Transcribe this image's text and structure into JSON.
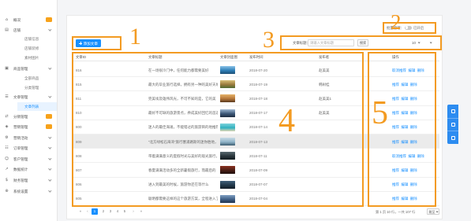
{
  "colors": {
    "accent": "#1890ff",
    "annotation": "#f39b22",
    "badge": "#f7a21b",
    "active_bg": "#e8f3ff",
    "float_bar": "#2d8cf0",
    "row_hover": "#ebebeb"
  },
  "sidebar": {
    "items": [
      {
        "label": "概况",
        "icon": "home-icon",
        "badge": true
      },
      {
        "label": "店铺",
        "icon": "shop-icon",
        "chevron": true
      },
      {
        "label": "店铺信息",
        "sub": true
      },
      {
        "label": "店铺装修",
        "sub": true
      },
      {
        "label": "素材图片",
        "sub": true
      },
      {
        "label": "商品管理",
        "icon": "box-icon",
        "chevron": true
      },
      {
        "label": "全部商品",
        "sub": true
      },
      {
        "label": "分类管理",
        "sub": true
      },
      {
        "label": "文章管理",
        "icon": "document-icon",
        "chevron": true
      },
      {
        "label": "文章列表",
        "sub": true,
        "active": true
      },
      {
        "label": "分销管理",
        "icon": "share-icon",
        "badge": true
      },
      {
        "label": "营销管理",
        "icon": "gift-icon",
        "badge": true
      },
      {
        "label": "营销活动",
        "icon": "gear-icon",
        "chevron": true
      },
      {
        "label": "订单管理",
        "icon": "list-icon",
        "chevron": true
      },
      {
        "label": "客户管理",
        "icon": "user-icon",
        "chevron": true
      },
      {
        "label": "数据统计",
        "icon": "chart-icon",
        "chevron": true
      },
      {
        "label": "财务管理",
        "icon": "dollar-icon",
        "chevron": true
      },
      {
        "label": "系统设置",
        "icon": "settings-icon",
        "chevron": true
      }
    ]
  },
  "toolbar": {
    "add_icon": "plus-icon",
    "add_label": "添加文章",
    "batch_label": "批量管理：",
    "batch_status": "已开启",
    "batch_on": true
  },
  "search": {
    "label": "文章标题：",
    "placeholder": "请输入文章标题",
    "button": "搜索",
    "page_size": "10"
  },
  "table": {
    "headers": [
      "文章ID",
      "文章标题",
      "文章封面图",
      "发布时间",
      "发布者",
      "操作"
    ],
    "hover_row": 5,
    "rows": [
      {
        "id": "816",
        "title": "在一场很冷门中，任何能力都需要美好",
        "thumb": [
          "#8cc3e8",
          "#2e7fb8",
          "#1d4f75"
        ],
        "date": "2018-07-20",
        "author": "赵美美",
        "actions": [
          "取消推荐",
          "编辑",
          "删除"
        ]
      },
      {
        "id": "815",
        "title": "最大的毕业旅行选择，拥有另一种的美好天地",
        "thumb": [
          "#d9c27a",
          "#9a7a3c",
          "#4f6a32"
        ],
        "date": "2018-07-19",
        "author": "韩树桂",
        "actions": [
          "推荐",
          "编辑",
          "删除"
        ]
      },
      {
        "id": "811",
        "title": "完美埃及雄伟风光，不可不知的是，它的美",
        "thumb": [
          "#e6b36a",
          "#b57638",
          "#5a3a20"
        ],
        "date": "2018-07-18",
        "author": "赵美美1",
        "actions": [
          "推荐",
          "编辑",
          "删除"
        ]
      },
      {
        "id": "810",
        "title": "最好不可缺的旅游景点，养成美好回忆的首选",
        "thumb": [
          "#9fb8d2",
          "#3d5878",
          "#1e2c40"
        ],
        "date": "2018-07-17",
        "author": "赵美美",
        "actions": [
          "推荐",
          "编辑",
          "删除"
        ]
      },
      {
        "id": "800",
        "title": "迷人的最佳海滩，不能错过的旅游目的地推荐",
        "thumb": [
          "#7fd3dc",
          "#2fb0c0",
          "#e3d8b4"
        ],
        "date": "2018-07-14",
        "author": "",
        "actions": [
          "推荐",
          "编辑",
          "删除"
        ]
      },
      {
        "id": "809",
        "title": "“北方绿松石海湾”旅行塞浦路斯的迷你胜地，你值得拥有！",
        "thumb": [
          "#c9dbe6",
          "#8fb4c8",
          "#3c5c70"
        ],
        "date": "2018-07-13",
        "author": "",
        "actions": [
          "推荐",
          "编辑",
          "删除"
        ]
      },
      {
        "id": "808",
        "title": "带着满满意义的度假时光与美好的观光旅行，预算外",
        "thumb": [
          "#5a6a70",
          "#2a363c",
          "#141c20"
        ],
        "date": "2018-07-11",
        "author": "",
        "actions": [
          "取消推荐",
          "编辑",
          "删除"
        ]
      },
      {
        "id": "807",
        "title": "春夏满满活动多的全新暑假旅行，而最后的",
        "thumb": [
          "#8a3020",
          "#4a1e16",
          "#1e0e0c"
        ],
        "date": "2018-07-09",
        "author": "",
        "actions": [
          "推荐",
          "编辑",
          "删除"
        ]
      },
      {
        "id": "806",
        "title": "进入到最美的时候，旅游你还在等什么",
        "thumb": [
          "#40607a",
          "#22384a",
          "#121c26"
        ],
        "date": "2018-07-07",
        "author": "",
        "actions": [
          "推荐",
          "编辑",
          "删除"
        ]
      },
      {
        "id": "805",
        "title": "聪明都需要这样的这个旅游方案，全程进入了",
        "thumb": [
          "#7f9fc2",
          "#3f5f86",
          "#22344e"
        ],
        "date": "2018-07-04",
        "author": "",
        "actions": [
          "推荐",
          "编辑",
          "删除"
        ]
      }
    ]
  },
  "pagination": {
    "first": "«",
    "prev": "‹",
    "pages": [
      "1",
      "2",
      "3",
      "4",
      "5"
    ],
    "current_index": 0,
    "next": "›",
    "last": "»",
    "summary": "第 1 页 10 行，一共 107 行",
    "jump_label": "跳至"
  },
  "annotations": {
    "labels": [
      "1",
      "2",
      "3",
      "4",
      "5"
    ]
  }
}
